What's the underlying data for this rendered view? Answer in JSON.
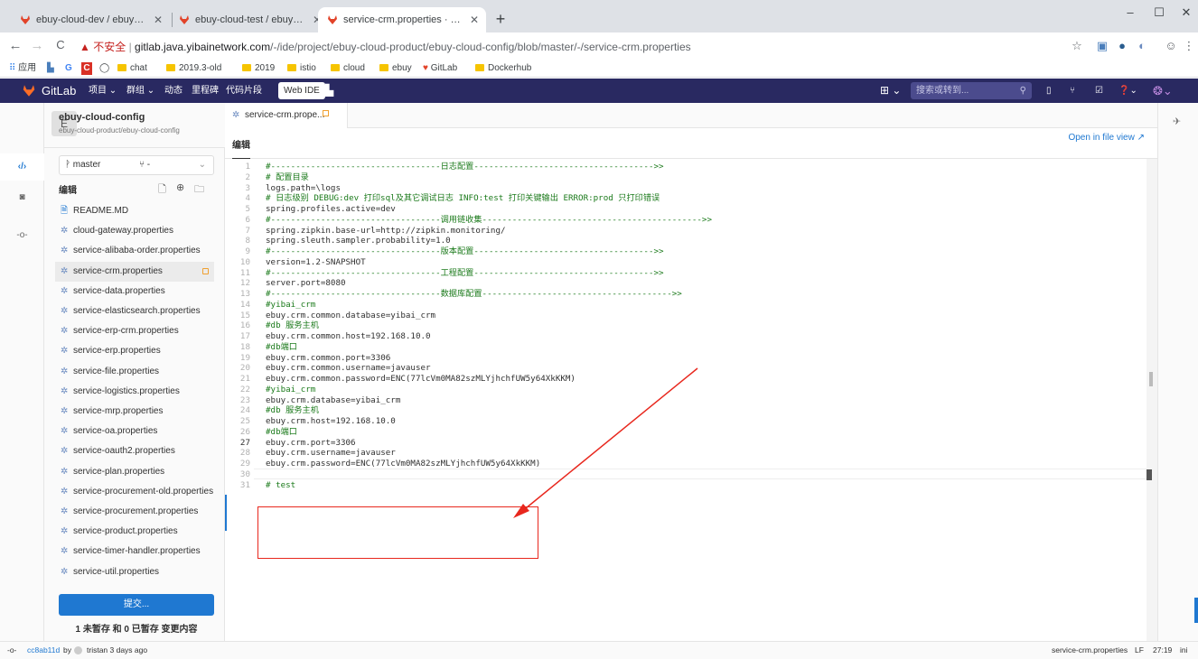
{
  "browser": {
    "tabs": [
      {
        "title": "ebuy-cloud-dev / ebuy-cloud",
        "active": false
      },
      {
        "title": "ebuy-cloud-test / ebuy-cloud",
        "active": false
      },
      {
        "title": "service-crm.properties · maste",
        "active": true
      }
    ],
    "new_tab": "+",
    "window_controls": {
      "minimize": "–",
      "maximize": "☐",
      "close": "✕"
    },
    "nav": {
      "back": "←",
      "forward": "→",
      "reload": "C"
    },
    "address": {
      "warning": "▲ 不安全",
      "separator": "|",
      "host": "gitlab.java.yibainetwork.com",
      "path": "/-/ide/project/ebuy-cloud-product/ebuy-cloud-config/blob/master/-/service-crm.properties"
    },
    "bookmarks": [
      {
        "label": "应用",
        "icon": "apps-icon"
      },
      {
        "label": "",
        "icon": "bookmark-icon"
      },
      {
        "label": "",
        "icon": "google-icon"
      },
      {
        "label": "",
        "icon": "c-icon"
      },
      {
        "label": "",
        "icon": "github-icon"
      },
      {
        "label": "chat",
        "icon": "folder-icon"
      },
      {
        "label": "2019.3-old",
        "icon": "folder-icon"
      },
      {
        "label": "2019",
        "icon": "folder-icon"
      },
      {
        "label": "istio",
        "icon": "folder-icon"
      },
      {
        "label": "cloud",
        "icon": "folder-icon"
      },
      {
        "label": "ebuy",
        "icon": "folder-icon"
      },
      {
        "label": "GitLab",
        "icon": "gitlab-icon"
      },
      {
        "label": "Dockerhub",
        "icon": "folder-icon"
      }
    ]
  },
  "gitlab_header": {
    "brand": "GitLab",
    "menu": [
      "项目 ⌄",
      "群组 ⌄",
      "动态",
      "里程碑",
      "代码片段"
    ],
    "web_ide": "Web IDE",
    "search_placeholder": "搜索或转到..."
  },
  "project": {
    "avatar_letter": "E",
    "name": "ebuy-cloud-config",
    "path": "ebuy-cloud-product/ebuy-cloud-config"
  },
  "sidebar": {
    "branch": "master",
    "merge": "⌄",
    "edit_title": "编辑",
    "files": [
      {
        "name": "README.MD",
        "active": false,
        "modified": false
      },
      {
        "name": "cloud-gateway.properties",
        "active": false,
        "modified": false
      },
      {
        "name": "service-alibaba-order.properties",
        "active": false,
        "modified": false
      },
      {
        "name": "service-crm.properties",
        "active": true,
        "modified": true
      },
      {
        "name": "service-data.properties",
        "active": false,
        "modified": false
      },
      {
        "name": "service-elasticsearch.properties",
        "active": false,
        "modified": false
      },
      {
        "name": "service-erp-crm.properties",
        "active": false,
        "modified": false
      },
      {
        "name": "service-erp.properties",
        "active": false,
        "modified": false
      },
      {
        "name": "service-file.properties",
        "active": false,
        "modified": false
      },
      {
        "name": "service-logistics.properties",
        "active": false,
        "modified": false
      },
      {
        "name": "service-mrp.properties",
        "active": false,
        "modified": false
      },
      {
        "name": "service-oa.properties",
        "active": false,
        "modified": false
      },
      {
        "name": "service-oauth2.properties",
        "active": false,
        "modified": false
      },
      {
        "name": "service-plan.properties",
        "active": false,
        "modified": false
      },
      {
        "name": "service-procurement-old.properties",
        "active": false,
        "modified": false
      },
      {
        "name": "service-procurement.properties",
        "active": false,
        "modified": false
      },
      {
        "name": "service-product.properties",
        "active": false,
        "modified": false
      },
      {
        "name": "service-timer-handler.properties",
        "active": false,
        "modified": false
      },
      {
        "name": "service-util.properties",
        "active": false,
        "modified": false
      }
    ],
    "commit_button": "提交...",
    "commit_info": "1 未暂存 和 0 已暂存 变更内容"
  },
  "editor": {
    "tab_title": "service-crm.prope...",
    "mode_label": "编辑",
    "open_in_file_view": "Open in file view",
    "current_line": 27,
    "lines": [
      "#----------------------------------日志配置------------------------------------>>",
      "# 配置目录",
      "logs.path=\\logs",
      "# 日志级别 DEBUG:dev 打印sql及其它调试日志 INFO:test 打印关键输出 ERROR:prod 只打印错误",
      "spring.profiles.active=dev",
      "#----------------------------------调用链收集-------------------------------------------->>",
      "spring.zipkin.base-url=http://zipkin.monitoring/",
      "spring.sleuth.sampler.probability=1.0",
      "#----------------------------------版本配置------------------------------------>>",
      "version=1.2-SNAPSHOT",
      "#----------------------------------工程配置------------------------------------>>",
      "server.port=8080",
      "#----------------------------------数据库配置-------------------------------------->>",
      "#yibai_crm",
      "ebuy.crm.common.database=yibai_crm",
      "#db 服务主机",
      "ebuy.crm.common.host=192.168.10.0",
      "#db端口",
      "ebuy.crm.common.port=3306",
      "ebuy.crm.common.username=javauser",
      "ebuy.crm.common.password=ENC(77lcVm0MA82szMLYjhchfUW5y64XkKKM)",
      "#yibai_crm",
      "ebuy.crm.database=yibai_crm",
      "#db 服务主机",
      "ebuy.crm.host=192.168.10.0",
      "#db端口",
      "ebuy.crm.port=3306",
      "ebuy.crm.username=javauser",
      "ebuy.crm.password=ENC(77lcVm0MA82szMLYjhchfUW5y64XkKKM)",
      "",
      "# test"
    ]
  },
  "status_bar": {
    "commit": "cc8ab11d",
    "by": "by",
    "author": "tristan 3 days ago",
    "file": "service-crm.properties",
    "eol": "LF",
    "position": "27:19",
    "encoding": "ini"
  },
  "annotation_color": "#e8271d",
  "accent_color": "#1f78d1"
}
